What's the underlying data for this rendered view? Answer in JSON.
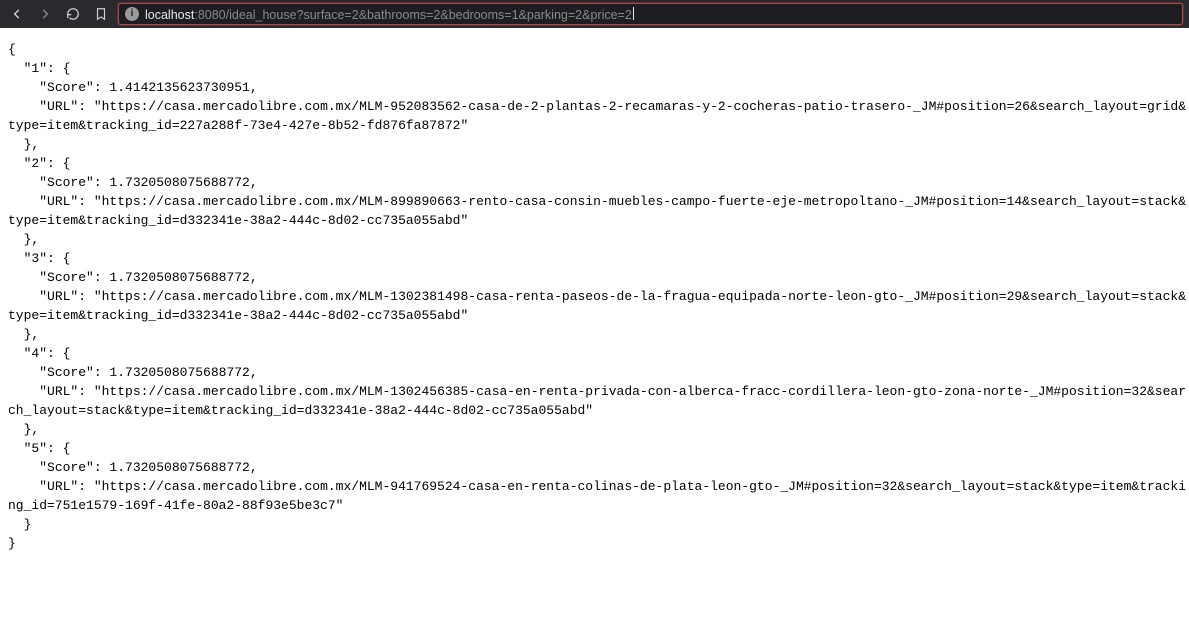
{
  "toolbar": {
    "url_host": "localhost",
    "url_port_and_path": ":8080/ideal_house?surface=2&bathrooms=2&bedrooms=1&parking=2&price=2",
    "info_glyph": "i"
  },
  "response": {
    "1": {
      "Score": 1.4142135623730951,
      "URL": "https://casa.mercadolibre.com.mx/MLM-952083562-casa-de-2-plantas-2-recamaras-y-2-cocheras-patio-trasero-_JM#position=26&search_layout=grid&type=item&tracking_id=227a288f-73e4-427e-8b52-fd876fa87872"
    },
    "2": {
      "Score": 1.7320508075688772,
      "URL": "https://casa.mercadolibre.com.mx/MLM-899890663-rento-casa-consin-muebles-campo-fuerte-eje-metropoltano-_JM#position=14&search_layout=stack&type=item&tracking_id=d332341e-38a2-444c-8d02-cc735a055abd"
    },
    "3": {
      "Score": 1.7320508075688772,
      "URL": "https://casa.mercadolibre.com.mx/MLM-1302381498-casa-renta-paseos-de-la-fragua-equipada-norte-leon-gto-_JM#position=29&search_layout=stack&type=item&tracking_id=d332341e-38a2-444c-8d02-cc735a055abd"
    },
    "4": {
      "Score": 1.7320508075688772,
      "URL": "https://casa.mercadolibre.com.mx/MLM-1302456385-casa-en-renta-privada-con-alberca-fracc-cordillera-leon-gto-zona-norte-_JM#position=32&search_layout=stack&type=item&tracking_id=d332341e-38a2-444c-8d02-cc735a055abd"
    },
    "5": {
      "Score": 1.7320508075688772,
      "URL": "https://casa.mercadolibre.com.mx/MLM-941769524-casa-en-renta-colinas-de-plata-leon-gto-_JM#position=32&search_layout=stack&type=item&tracking_id=751e1579-169f-41fe-80a2-88f93e5be3c7"
    }
  }
}
